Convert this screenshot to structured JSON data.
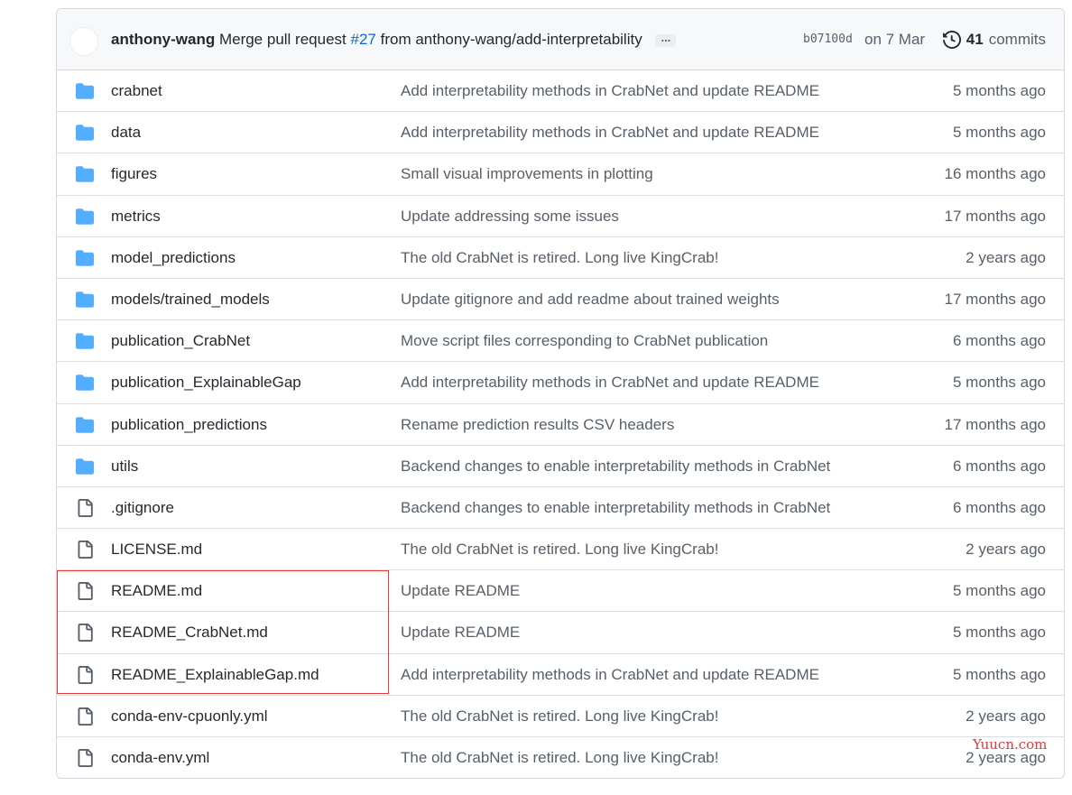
{
  "commit": {
    "author": "anthony-wang",
    "message_prefix": "Merge pull request",
    "pr_number": "#27",
    "message_suffix": "from anthony-wang/add-interpretability",
    "ellipsis": "...",
    "sha": "b07100d",
    "date": "on 7 Mar",
    "commit_count": "41",
    "commit_label": "commits"
  },
  "files": [
    {
      "type": "folder",
      "icon": "folder-icon",
      "name": "crabnet",
      "message": "Add interpretability methods in CrabNet and update README",
      "age": "5 months ago"
    },
    {
      "type": "folder",
      "icon": "folder-icon",
      "name": "data",
      "message": "Add interpretability methods in CrabNet and update README",
      "age": "5 months ago"
    },
    {
      "type": "folder",
      "icon": "folder-icon",
      "name": "figures",
      "message": "Small visual improvements in plotting",
      "age": "16 months ago"
    },
    {
      "type": "folder",
      "icon": "folder-icon",
      "name": "metrics",
      "message": "Update addressing some issues",
      "age": "17 months ago"
    },
    {
      "type": "folder",
      "icon": "folder-icon",
      "name": "model_predictions",
      "message": "The old CrabNet is retired. Long live KingCrab!",
      "age": "2 years ago"
    },
    {
      "type": "folder",
      "icon": "folder-icon",
      "name": "models/trained_models",
      "message": "Update gitignore and add readme about trained weights",
      "age": "17 months ago"
    },
    {
      "type": "folder",
      "icon": "folder-icon",
      "name": "publication_CrabNet",
      "message": "Move script files corresponding to CrabNet publication",
      "age": "6 months ago"
    },
    {
      "type": "folder",
      "icon": "folder-icon",
      "name": "publication_ExplainableGap",
      "message": "Add interpretability methods in CrabNet and update README",
      "age": "5 months ago"
    },
    {
      "type": "folder",
      "icon": "folder-icon",
      "name": "publication_predictions",
      "message": "Rename prediction results CSV headers",
      "age": "17 months ago"
    },
    {
      "type": "folder",
      "icon": "folder-icon",
      "name": "utils",
      "message": "Backend changes to enable interpretability methods in CrabNet",
      "age": "6 months ago"
    },
    {
      "type": "file",
      "icon": "file-icon",
      "name": ".gitignore",
      "message": "Backend changes to enable interpretability methods in CrabNet",
      "age": "6 months ago"
    },
    {
      "type": "file",
      "icon": "file-icon",
      "name": "LICENSE.md",
      "message": "The old CrabNet is retired. Long live KingCrab!",
      "age": "2 years ago"
    },
    {
      "type": "file",
      "icon": "file-icon",
      "name": "README.md",
      "message": "Update README",
      "age": "5 months ago"
    },
    {
      "type": "file",
      "icon": "file-icon",
      "name": "README_CrabNet.md",
      "message": "Update README",
      "age": "5 months ago"
    },
    {
      "type": "file",
      "icon": "file-icon",
      "name": "README_ExplainableGap.md",
      "message": "Add interpretability methods in CrabNet and update README",
      "age": "5 months ago"
    },
    {
      "type": "file",
      "icon": "file-icon",
      "name": "conda-env-cpuonly.yml",
      "message": "The old CrabNet is retired. Long live KingCrab!",
      "age": "2 years ago"
    },
    {
      "type": "file",
      "icon": "file-icon",
      "name": "conda-env.yml",
      "message": "The old CrabNet is retired. Long live KingCrab!",
      "age": "2 years ago"
    }
  ],
  "watermark": "Yuucn.com",
  "colors": {
    "folder": "#54aeff",
    "link": "#0969da",
    "muted": "#57606a",
    "highlight": "#e03a3a"
  }
}
